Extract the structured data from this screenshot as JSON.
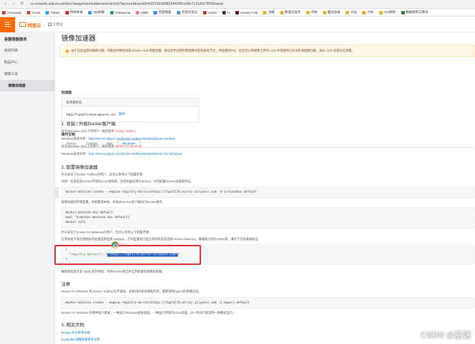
{
  "browser": {
    "url": "cr.console.aliyun.com/cn-hangzhou/instances/mirrors?accounttraceid=b327d2a5f8024434b1d9e71316b73009oarw",
    "bookmarks": [
      "Chinadaily",
      "Gmail",
      "Twitter",
      "网易新闻",
      "QQ邮箱",
      "chatopenai",
      "bilibili",
      "百度网盘",
      "有道云笔记",
      "CSDN",
      "AI",
      "Greasy Fork",
      "流媒",
      "数理与程序",
      "开发",
      "面试准备",
      "论坛",
      "力扣",
      "401教程",
      "数据结构与算法"
    ],
    "bookmark_colors": [
      "#c33",
      "#d44",
      "#1da1f2",
      "#c22",
      "#2a9df4",
      "#10a37f",
      "#fb7299",
      "#3385ff",
      "#4a90d9",
      "#c0392b",
      "#333",
      "#670000",
      "#e6b422",
      "#e6b422",
      "#e6b422",
      "#e6b422",
      "#e6b422",
      "#f0a020",
      "#e6b422",
      "#2e7d32"
    ]
  },
  "topbar": {
    "brand": "阿里云",
    "workbench": "工作台"
  },
  "sidebar": {
    "title": "容器镜像服务",
    "items": [
      {
        "label": "实例列表",
        "active": false
      },
      {
        "label": "制品中心",
        "active": false
      },
      {
        "label": "镜像工具",
        "active": false
      },
      {
        "label": "镜像加速器",
        "active": true
      }
    ]
  },
  "main": {
    "title": "镜像加速器",
    "notice": "由于当前运营商网络问题，可能会导致您拉取 Docker Hub 镜像变慢，建议您手动把所需镜像托管到本地节点，然后重新Pull，您也可以将镜像上传到 ACR 中或使用已有海外源镜像功能，再从 ACR 拉取对应镜像。",
    "accelerator": {
      "section": "加速器",
      "header": "加速器地址",
      "address": "https://7upt1l74.mirror.aliyuncs.com",
      "copy": "复制"
    },
    "docs": {
      "section": "操作文档",
      "tabs": [
        "Ubuntu",
        "CentOS",
        "Mac",
        "Windows"
      ],
      "active_tab": "Windows",
      "s1_title": "1. 安装 / 升级Docker客户端",
      "s1_l1_prefix": "对于Windows 10以下的用户，推荐使用",
      "s1_l1_link": "Docker Toolbox",
      "s1_l2_prefix": "Windows安装文件：",
      "s1_l2_link": "http://mirrors.aliyun.com/docker-toolbox/windows/docker-toolbox/",
      "s1_l3_prefix": "对于Windows 10以上的用户，推荐使用",
      "s1_l3_link": "Docker for Windows",
      "s1_l4_prefix": "Windows安装文件：",
      "s1_l4_link": "http://mirrors.aliyun.com/docker-toolbox/windows/docker-for-windows/",
      "s2_title": "2. 配置镜像加速器",
      "s2_p1": "针对安装了Docker Toolbox的用户，您可以参考以下配置步骤：",
      "s2_p2": "创建一台安装有Docker环境的Linux虚拟机，指定机器名称为default，同时配置Docker加速器地址。",
      "code1": "docker-machine create --engine-registry-mirror=https://7upt1l74.mirror.aliyuncs.com -d virtualbox default",
      "s2_p3": "查看机器的环境配置，并配置到本地，并通过Docker客户端访问Docker服务。",
      "code2": "docker-machine env default\neval \"$(docker-machine env default)\"\ndocker info",
      "s2_p4": "针对安装了Docker for Windows的用户，您可以参考以下配置步骤：",
      "s2_p5": "在系统右下角托盘图标内右键菜单选择 Settings，打开配置窗口后左侧导航菜单选择 Docker Daemon。编辑窗口内的JSON串，填写下方加速器地址：",
      "code3_open": "{",
      "code3_key": "\"registry-mirrors\": [",
      "code3_val": "\"https://7upt1l74.mirror.aliyuncs.com\"",
      "code3_end": "]",
      "code3_close": "}",
      "s2_p6": "编辑完成后点击 Apply 保存按钮，等待Docker重启并应用配置的镜像加速器。",
      "note_title": "注意",
      "note_p": "Docker for Windows 和 Docker Toolbox互不兼容，如果同时安装两者的话，需要使用hyperv的参数启动。",
      "code4": "docker-machine create --engine-registry-mirror=https://7upt1l74.mirror.aliyuncs.com -d hyperv default",
      "note_p2": "Docker for Windows 有两种运行模式，一种运行Windows相关容器，一种运行传统的Linux容器。同一时间只能选择一种模式运行。",
      "s3_title": "3. 相关文档",
      "s3_l1_prefix": "Docker",
      "s3_l1_link": "命令参考文档",
      "s3_l2_prefix": "Dockerfile",
      "s3_l2_link": "镜像构建参考文档"
    }
  },
  "watermark": "CSDN @星谐"
}
